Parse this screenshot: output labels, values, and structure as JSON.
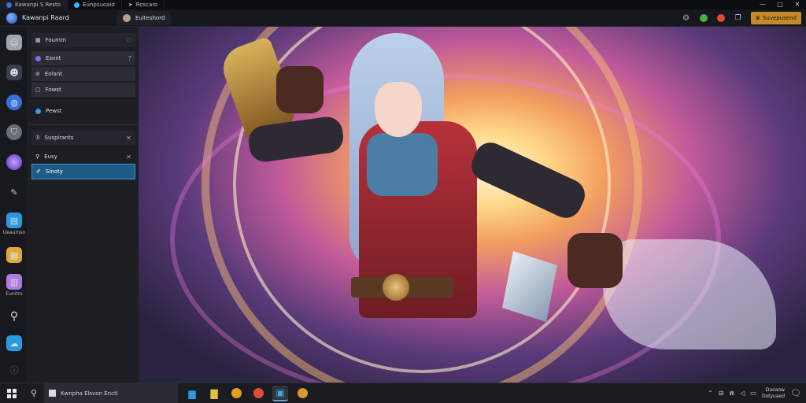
{
  "titlebar": {
    "tabs": [
      {
        "label": "Kawanpi S Resto",
        "color": "#3a6fe0"
      },
      {
        "label": "Eunpsuoaid",
        "color": "#3ab0ff"
      },
      {
        "label": "Roscaro",
        "color": "#c9ccd3"
      }
    ],
    "controls": [
      "—",
      "□",
      "✕"
    ]
  },
  "header": {
    "app_title": "Kawanpi Raard",
    "breadcrumb": "Euiteshord",
    "upgrade_label": "Suvepusend"
  },
  "rail": {
    "items": [
      {
        "icon": "profile-icon",
        "label": "",
        "color": "#9ea3ad"
      },
      {
        "icon": "character-icon",
        "label": "",
        "color": "#3b3f49"
      },
      {
        "icon": "globe-icon",
        "label": "",
        "color": "#3a6fe0"
      },
      {
        "icon": "shield-icon",
        "label": "",
        "color": "#6a6e78"
      },
      {
        "icon": "orb-icon",
        "label": "",
        "color": "#7a4fe0"
      },
      {
        "icon": "brush-icon",
        "label": "",
        "color": "#c9ccd3"
      },
      {
        "icon": "folder-icon",
        "label": "Ueaumso",
        "color": "#2a9ae0"
      },
      {
        "icon": "palette-icon",
        "label": "",
        "color": "#e0a83a"
      },
      {
        "icon": "document-icon",
        "label": "Eunitro",
        "color": "#b07ae0"
      },
      {
        "icon": "search-icon",
        "label": "",
        "color": "#d8dbe2"
      },
      {
        "icon": "cloud-icon",
        "label": "",
        "color": "#2a9ae0"
      },
      {
        "icon": "info-icon",
        "label": "",
        "color": "#6a6e78"
      }
    ]
  },
  "panel": {
    "top_header": "Foumtn",
    "items": [
      "Esont",
      "Eolant",
      "Fowst",
      "Pewst"
    ],
    "section_header": "Suspirants",
    "section_items": [
      "Eusy",
      "Sinoty"
    ]
  },
  "taskbar": {
    "search_text": "Kwnpha Elsvon Enctl",
    "apps": [
      {
        "icon": "folder-icon",
        "color": "#2a9ae0"
      },
      {
        "icon": "files-icon",
        "color": "#e0c23a"
      },
      {
        "icon": "chrome-icon",
        "color": "#e0a020"
      },
      {
        "icon": "record-icon",
        "color": "#e04a3a"
      },
      {
        "icon": "app-icon",
        "color": "#3ab0e0"
      },
      {
        "icon": "settings-icon",
        "color": "#d89a30"
      }
    ],
    "time": "Daoaow",
    "date": "Dotyuaed"
  },
  "colors": {
    "accent": "#3d93cf",
    "upgrade": "#c78a2a"
  }
}
